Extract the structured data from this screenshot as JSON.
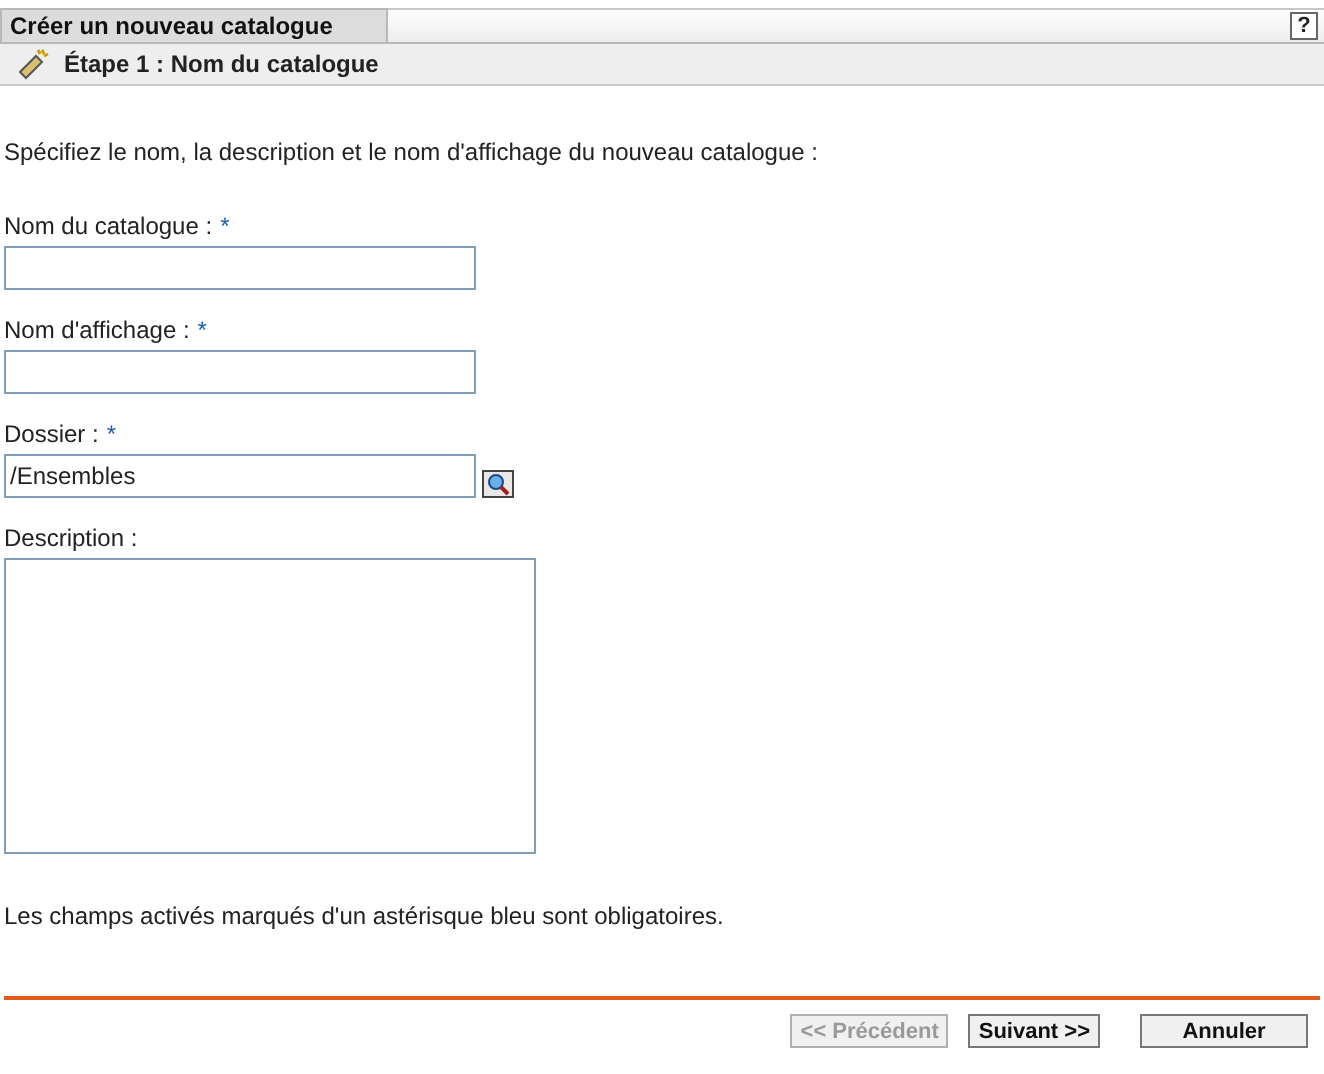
{
  "window": {
    "title": "Créer un nouveau catalogue",
    "help": "?"
  },
  "step": {
    "title": "Étape 1 : Nom du catalogue"
  },
  "intro": "Spécifiez le nom, la description et le nom d'affichage du nouveau catalogue :",
  "fields": [
    {
      "kind": "text",
      "label": "Nom du catalogue :",
      "required": true
    },
    {
      "kind": "text",
      "label": "Nom d'affichage :",
      "required": true
    },
    {
      "kind": "browse",
      "label": "Dossier :",
      "required": true,
      "value": "/Ensembles"
    },
    {
      "kind": "textarea",
      "label": "Description :",
      "required": false
    }
  ],
  "required_mark": "*",
  "note": "Les champs activés marqués d'un astérisque bleu sont obligatoires.",
  "buttons": [
    {
      "label": "<< Précédent",
      "disabled": true
    },
    {
      "label": "Suivant >>",
      "disabled": false
    },
    {
      "label": "Annuler",
      "disabled": false
    }
  ]
}
